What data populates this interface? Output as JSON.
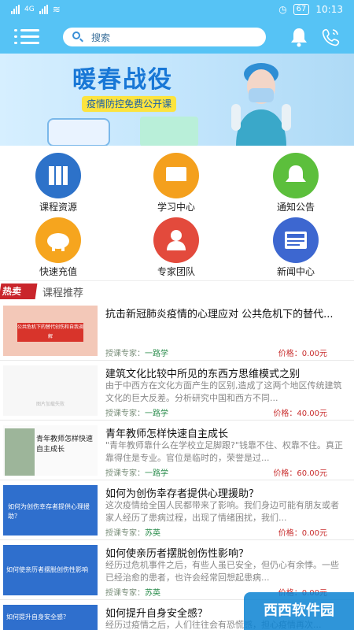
{
  "status": {
    "network": "4G",
    "time": "10:13",
    "battery": "67"
  },
  "header": {
    "search_placeholder": "搜索"
  },
  "banner": {
    "title": "暖春战役",
    "subtitle": "疫情防控免费公开课"
  },
  "grid": [
    {
      "label": "课程资源",
      "icon": "books-icon",
      "color": "#2d72c9"
    },
    {
      "label": "学习中心",
      "icon": "book-icon",
      "color": "#f4a01d"
    },
    {
      "label": "通知公告",
      "icon": "bell-icon",
      "color": "#5cbf3c"
    },
    {
      "label": "快速充值",
      "icon": "piggy-bank-icon",
      "color": "#f6a51e"
    },
    {
      "label": "专家团队",
      "icon": "expert-icon",
      "color": "#e34a3c"
    },
    {
      "label": "新闻中心",
      "icon": "news-icon",
      "color": "#3d67d0"
    }
  ],
  "section": {
    "badge": "热卖",
    "title": "课程推荐",
    "expert_prefix": "授课专家：",
    "price_prefix": "价格："
  },
  "courses": [
    {
      "title": "抗击新冠肺炎疫情的心理应对 公共危机下的替代...",
      "desc": "",
      "expert": "一路学",
      "price": "0.00元",
      "thumb_text": "公共危机下的替代创伤和自我调解"
    },
    {
      "title": "建筑文化比较中所见的东西方思维模式之别",
      "desc": "由于中西方在文化方面产生的区别,造成了这两个地区传统建筑文化的巨大反差。分析研究中国和西方不同...",
      "expert": "一路学",
      "price": "40.00元",
      "thumb_text": "图片加载失败"
    },
    {
      "title": "青年教师怎样快速自主成长",
      "desc": "\"青年教师靠什么在学校立足脚跟?\"钱靠不住、权靠不住。真正靠得住是专业。官位是临时的，荣誉是过...",
      "expert": "一路学",
      "price": "60.00元",
      "thumb_text": "青年教师怎样快速自主成长"
    },
    {
      "title": "如何为创伤幸存者提供心理援助？",
      "desc": "这次疫情给全国人民都带来了影响。我们身边可能有朋友或者家人经历了患病过程，出现了情绪困扰，我们...",
      "expert": "苏英",
      "price": "0.00元",
      "thumb_text": "如何为创伤幸存者提供心理援助？"
    },
    {
      "title": "如何使亲历者摆脱创伤性影响？",
      "desc": "经历过危机事件之后，有些人虽已安全，但仍心有余悸。一些已经治愈的患者，也许会经常回想起患病...",
      "expert": "苏英",
      "price": "0.00元",
      "thumb_text": "如何使亲历者摆脱创伤性影响"
    },
    {
      "title": "如何提升自身安全感？",
      "desc": "经历过疫情之后，人们往往会有恐慌感，担心疫情再次...",
      "expert": "",
      "price": "",
      "thumb_text": "如何提升自身安全感？"
    }
  ],
  "watermark": "西西软件园"
}
